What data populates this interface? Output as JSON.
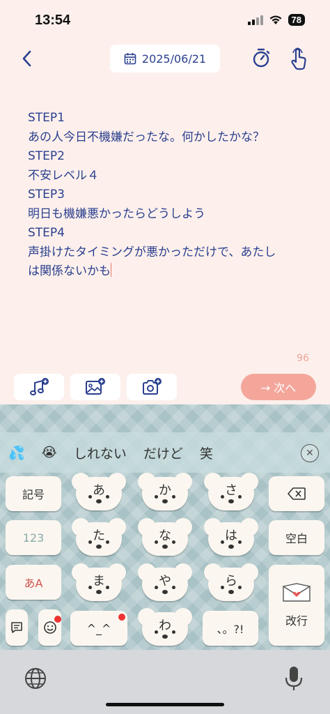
{
  "status": {
    "time": "13:54",
    "battery": "78"
  },
  "header": {
    "date": "2025/06/21"
  },
  "editor": {
    "lines": [
      "STEP1",
      "あの人今日不機嫌だったな。何かしたかな？",
      "STEP2",
      "不安レベル４",
      "STEP3",
      "明日も機嫌悪かったらどうしよう",
      "STEP4",
      "声掛けたタイミングが悪かっただけで、あたし",
      "は関係ないかも"
    ],
    "char_count": "96"
  },
  "toolbar": {
    "next_label": "→ 次へ"
  },
  "suggestions": [
    "💦",
    "😭",
    "しれない",
    "だけど",
    "笑"
  ],
  "keyboard": {
    "left_keys": {
      "symbol": "記号",
      "number": "123",
      "kana": "あA"
    },
    "kana_keys": [
      "あ",
      "か",
      "さ",
      "た",
      "な",
      "は",
      "ま",
      "や",
      "ら",
      "わ"
    ],
    "emoticon_key": "^_^",
    "punct_key": "、。?!",
    "space_key": "空白",
    "enter_key": "改行"
  },
  "colors": {
    "accent_blue": "#2a3f8f",
    "next_button": "#f4a69b",
    "background": "#fdf0ec"
  }
}
